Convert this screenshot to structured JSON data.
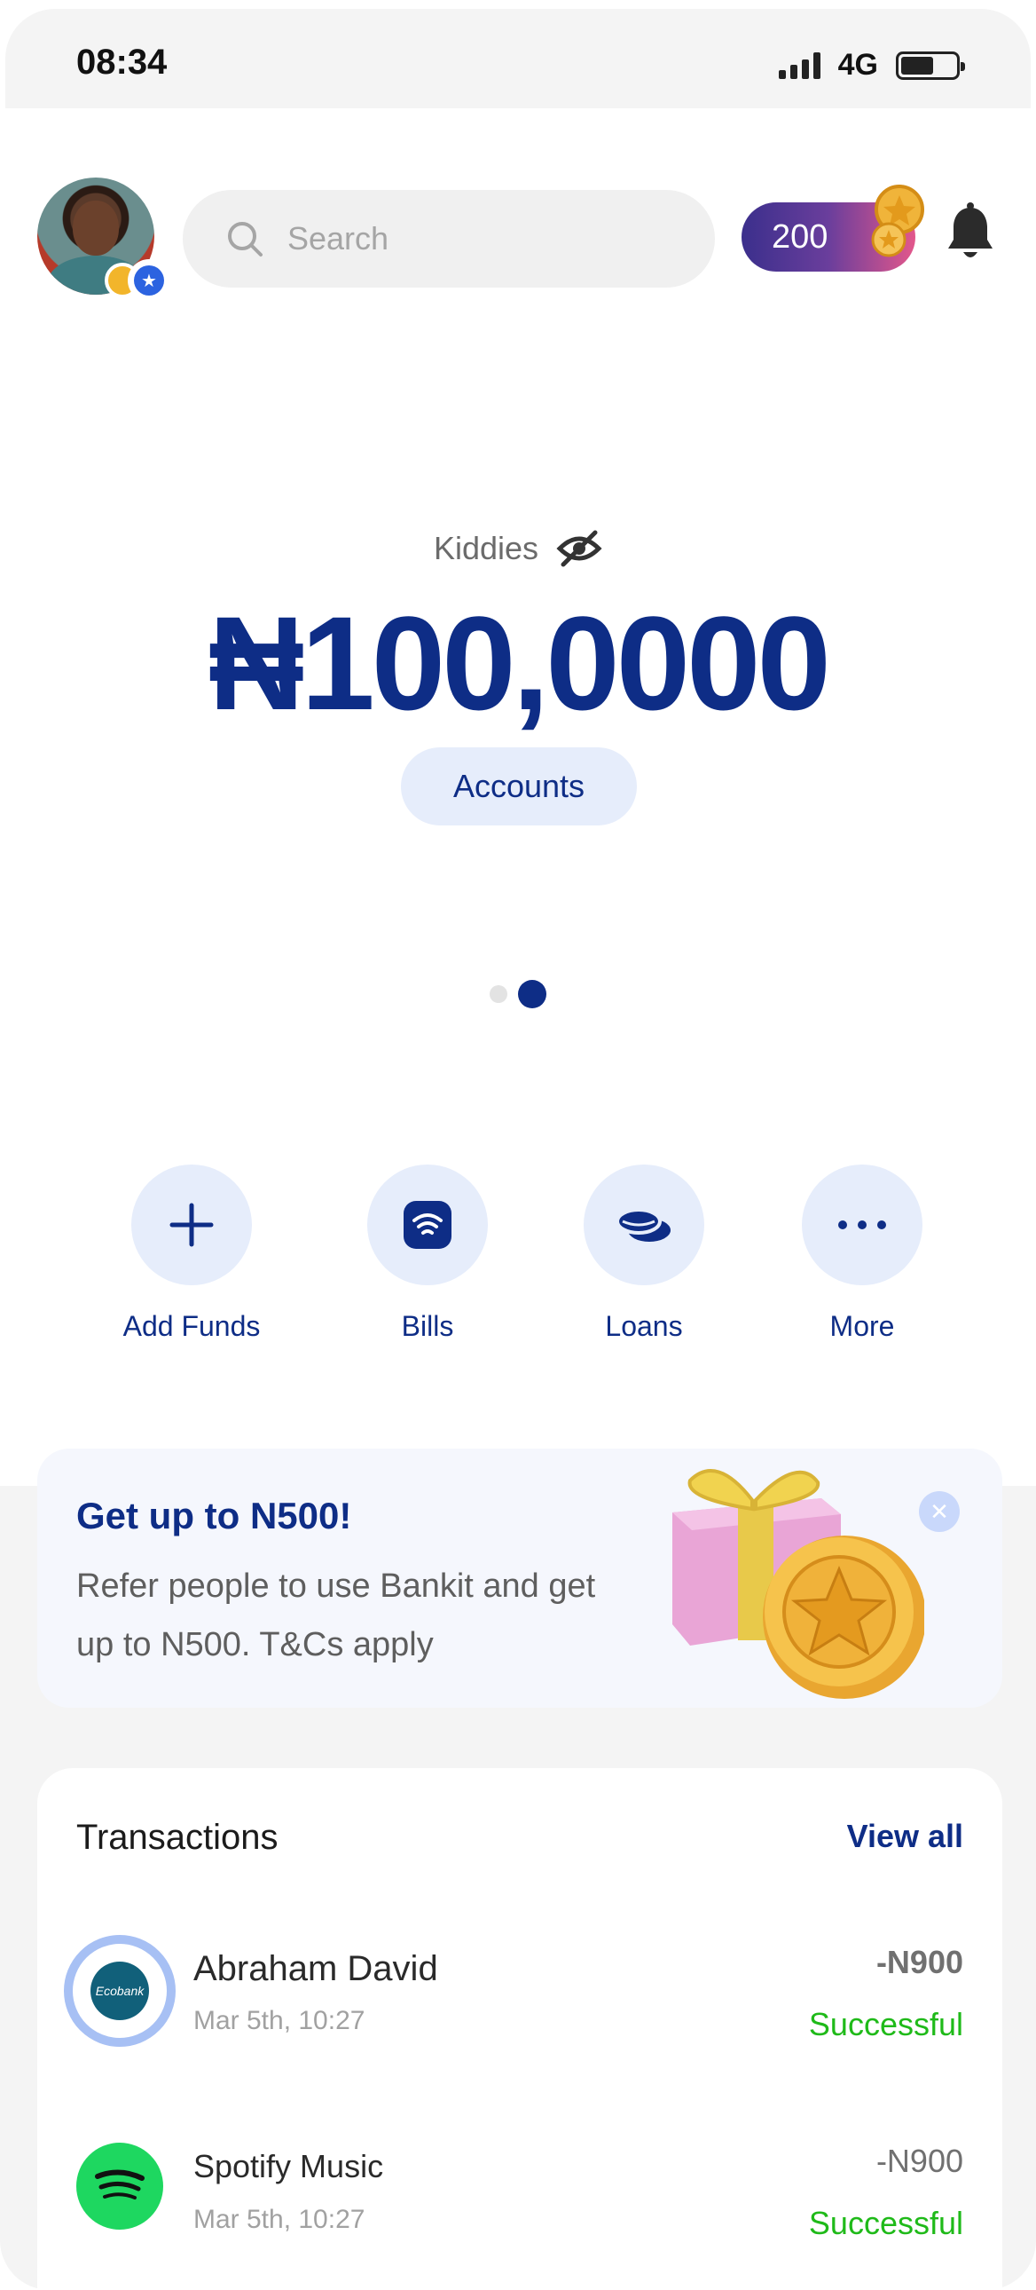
{
  "status_bar": {
    "time": "08:34",
    "network": "4G",
    "battery_level": 0.6
  },
  "header": {
    "search_placeholder": "Search",
    "points": "200",
    "icons": [
      "avatar",
      "shield-badge-icon",
      "search-icon",
      "coin-icon",
      "bell-icon"
    ]
  },
  "balance": {
    "account_name": "Kiddies",
    "amount": "₦100,0000",
    "accounts_button": "Accounts",
    "carousel_pages": 2,
    "carousel_active": 2
  },
  "actions": [
    {
      "label": "Add Funds",
      "icon": "plus-icon"
    },
    {
      "label": "Bills",
      "icon": "wifi-bill-icon"
    },
    {
      "label": "Loans",
      "icon": "coins-icon"
    },
    {
      "label": "More",
      "icon": "more-icon"
    }
  ],
  "promo": {
    "title": "Get up to N500!",
    "text": "Refer people to use Bankit and get up to N500. T&Cs apply"
  },
  "transactions": {
    "title": "Transactions",
    "view_all": "View all",
    "items": [
      {
        "name": "Abraham David",
        "date": "Mar 5th, 10:27",
        "amount": "-N900",
        "status": "Successful",
        "logo_text": "Ecobank"
      },
      {
        "name": "Spotify Music",
        "date": "Mar 5th, 10:27",
        "amount": "-N900",
        "status": "Successful"
      }
    ]
  },
  "colors": {
    "primary": "#0e2d86",
    "accent_light": "#e6edfb",
    "success": "#1fba19"
  }
}
